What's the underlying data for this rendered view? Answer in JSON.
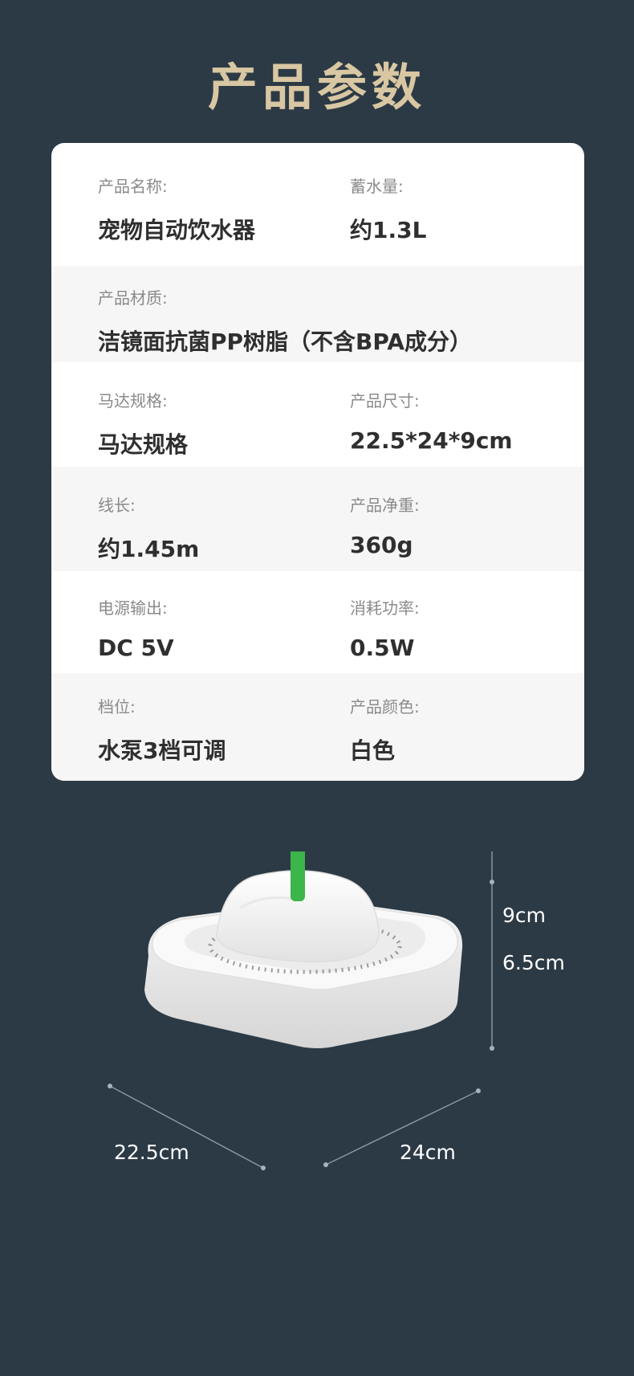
{
  "header": {
    "title": "产品参数"
  },
  "specs": [
    {
      "label": "产品名称:",
      "value": "宠物自动饮水器"
    },
    {
      "label": "蓄水量:",
      "value": "约1.3L"
    },
    {
      "label": "产品材质:",
      "value": "洁镜面抗菌PP树脂（不含BPA成分）"
    },
    {
      "label": "马达规格:",
      "value": "马达规格"
    },
    {
      "label": "产品尺寸:",
      "value": "22.5*24*9cm"
    },
    {
      "label": "线长:",
      "value": "约1.45m"
    },
    {
      "label": "产品净重:",
      "value": "360g"
    },
    {
      "label": "电源输出:",
      "value": "DC 5V"
    },
    {
      "label": "消耗功率:",
      "value": "0.5W"
    },
    {
      "label": "档位:",
      "value": "水泵3档可调"
    },
    {
      "label": "产品颜色:",
      "value": "白色"
    }
  ],
  "dimensions": {
    "height_total": "9cm",
    "height_body": "6.5cm",
    "width": "22.5cm",
    "depth": "24cm"
  },
  "colors": {
    "background": "#2c3a45",
    "title": "#d8c7a2",
    "card": "#ffffff",
    "alt_row": "#f6f6f6",
    "green_cap": "#3cb54a"
  }
}
